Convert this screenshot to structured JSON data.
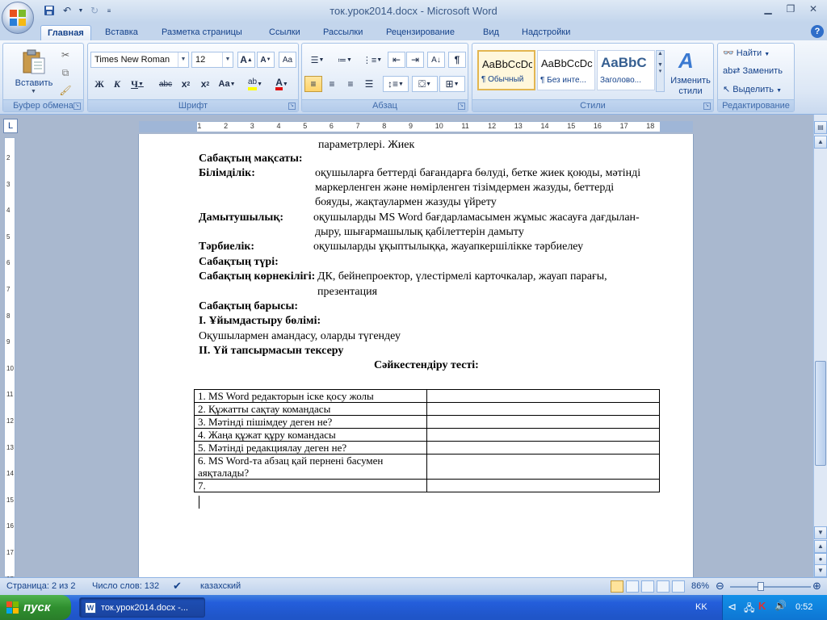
{
  "window": {
    "title": "ток.урок2014.docx - Microsoft Word"
  },
  "tabs": [
    "Главная",
    "Вставка",
    "Разметка страницы",
    "Ссылки",
    "Рассылки",
    "Рецензирование",
    "Вид",
    "Надстройки"
  ],
  "ribbon": {
    "clipboard": {
      "paste_label": "Вставить",
      "group_label": "Буфер обмена"
    },
    "font": {
      "font_name": "Times New Roman",
      "font_size": "12",
      "group_label": "Шрифт"
    },
    "paragraph": {
      "group_label": "Абзац"
    },
    "styles": {
      "items": [
        {
          "sample": "AaBbCcDc",
          "name": "¶ Обычный"
        },
        {
          "sample": "AaBbCcDc",
          "name": "¶ Без инте..."
        },
        {
          "sample": "AaBbC",
          "name": "Заголово..."
        }
      ],
      "change_label_1": "Изменить",
      "change_label_2": "стили",
      "group_label": "Стили"
    },
    "editing": {
      "find": "Найти",
      "replace": "Заменить",
      "select": "Выделить",
      "group_label": "Редактирование"
    }
  },
  "ruler": {
    "h_ticks": [
      "2",
      "1",
      "1",
      "2",
      "3",
      "4",
      "5",
      "6",
      "7",
      "8",
      "9",
      "10",
      "11",
      "12",
      "13",
      "14",
      "15",
      "16",
      "17",
      "18"
    ],
    "v_ticks": [
      "2",
      "3",
      "4",
      "5",
      "6",
      "7",
      "8",
      "9",
      "10",
      "11",
      "12",
      "13",
      "14",
      "15",
      "16",
      "17",
      "18",
      "19"
    ]
  },
  "document": {
    "lines": [
      {
        "text": "параметрлері. Жиек",
        "bold": false
      },
      {
        "text": "Сабақтың мақсаты:",
        "bold": true
      },
      {
        "text": "Білімділік:",
        "bold": true
      },
      {
        "text": "оқушыларға беттерді бағандарға бөлуді, бетке жиек қоюды, мәтінді",
        "bold": false
      },
      {
        "text": "маркерленген  және нөмірленген тізімдермен жазуды, беттерді",
        "bold": false
      },
      {
        "text": "бояуды, жақтаулармен жазуды үйрету",
        "bold": false
      },
      {
        "text": "Дамытушылық:",
        "bold": true
      },
      {
        "text": "оқушыларды MS Word бағдарламасымен жұмыс жасауға дағдылан-",
        "bold": false
      },
      {
        "text": "дыру, шығармашылық қабілеттерін дамыту",
        "bold": false
      },
      {
        "text": "Тәрбиелік:",
        "bold": true
      },
      {
        "text": "оқушыларды ұқыптылыққа, жауапкершілікке тәрбиелеу",
        "bold": false
      },
      {
        "text": "Сабақтың түрі:",
        "bold": true
      },
      {
        "text": "Сабақтың көрнекілігі:",
        "bold": true
      },
      {
        "text": "ДК, бейнепроектор, үлестірмелі карточкалар, жауап парағы,",
        "bold": false
      },
      {
        "text": "презентация",
        "bold": false
      },
      {
        "text": "Сабақтың барысы:",
        "bold": true
      },
      {
        "text": "І. Ұйымдастыру бөлімі:",
        "bold": true
      },
      {
        "text": "Оқушылармен амандасу, оларды түгендеу",
        "bold": false
      },
      {
        "text": "ІІ. Үй тапсырмасын тексеру",
        "bold": true
      },
      {
        "text": "Сәйкестендіру тесті:",
        "bold": true
      }
    ],
    "table": [
      "1. MS Word редакторын іске қосу жолы",
      "2. Құжатты сақтау командасы",
      "3. Мәтінді пішімдеу деген не?",
      "4. Жаңа құжат құру командасы",
      "5. Мәтінді редакциялау деген не?",
      "6. MS Word-та абзац қай пернені басумен аяқталады?",
      "7."
    ]
  },
  "status": {
    "page": "Страница: 2 из 2",
    "words": "Число слов: 132",
    "language": "казахский",
    "zoom": "86%"
  },
  "taskbar": {
    "start": "пуск",
    "task": "ток.урок2014.docx -...",
    "lang": "KK",
    "clock": "0:52"
  }
}
